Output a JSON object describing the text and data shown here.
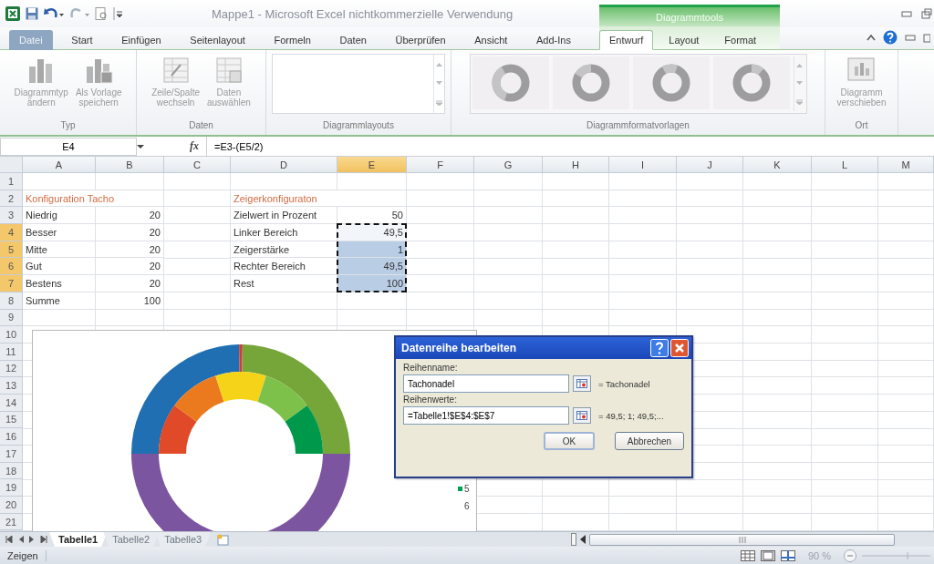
{
  "window": {
    "title": "Mappe1 - Microsoft Excel nichtkommerzielle Verwendung"
  },
  "context_tab_group": {
    "label": "Diagrammtools"
  },
  "ribbon_tabs": [
    {
      "label": "Datei",
      "kind": "file",
      "selected": false
    },
    {
      "label": "Start",
      "kind": "standard",
      "selected": false
    },
    {
      "label": "Einfügen",
      "kind": "standard",
      "selected": false
    },
    {
      "label": "Seitenlayout",
      "kind": "standard",
      "selected": false
    },
    {
      "label": "Formeln",
      "kind": "standard",
      "selected": false
    },
    {
      "label": "Daten",
      "kind": "standard",
      "selected": false
    },
    {
      "label": "Überprüfen",
      "kind": "standard",
      "selected": false
    },
    {
      "label": "Ansicht",
      "kind": "standard",
      "selected": false
    },
    {
      "label": "Add-Ins",
      "kind": "standard",
      "selected": false
    },
    {
      "label": "Entwurf",
      "kind": "context",
      "selected": true
    },
    {
      "label": "Layout",
      "kind": "context",
      "selected": false
    },
    {
      "label": "Format",
      "kind": "context",
      "selected": false
    }
  ],
  "ribbon_groups": [
    {
      "label": "Typ",
      "kind": "buttons",
      "buttons": [
        {
          "label": "Diagrammtyp\nändern",
          "disabled": true
        },
        {
          "label": "Als Vorlage\nspeichern",
          "disabled": true
        }
      ]
    },
    {
      "label": "Daten",
      "kind": "buttons",
      "buttons": [
        {
          "label": "Zeile/Spalte\nwechseln",
          "disabled": true
        },
        {
          "label": "Daten\nauswählen",
          "disabled": true
        }
      ]
    },
    {
      "label": "Diagrammlayouts",
      "kind": "gallery"
    },
    {
      "label": "Diagrammformatvorlagen",
      "kind": "styles"
    },
    {
      "label": "Ort",
      "kind": "buttons",
      "buttons": [
        {
          "label": "Diagramm\nverschieben",
          "disabled": true
        }
      ]
    }
  ],
  "formula_bar": {
    "name_box": "E4",
    "function_label": "fx",
    "formula": "=E3-(E5/2)"
  },
  "columns": [
    {
      "label": "A",
      "selected": false
    },
    {
      "label": "B",
      "selected": false
    },
    {
      "label": "C",
      "selected": false
    },
    {
      "label": "D",
      "selected": false
    },
    {
      "label": "E",
      "selected": true
    },
    {
      "label": "F",
      "selected": false
    },
    {
      "label": "G",
      "selected": false
    },
    {
      "label": "H",
      "selected": false
    },
    {
      "label": "I",
      "selected": false
    },
    {
      "label": "J",
      "selected": false
    },
    {
      "label": "K",
      "selected": false
    },
    {
      "label": "L",
      "selected": false
    },
    {
      "label": "M",
      "selected": false
    }
  ],
  "rows": [
    {
      "label": "1",
      "selected": false
    },
    {
      "label": "2",
      "selected": false,
      "cells": [
        {
          "text": "Konfiguration Tacho",
          "kind": "heading",
          "selected": false
        },
        null,
        null,
        {
          "text": "Zeigerkonfiguraton",
          "kind": "heading",
          "selected": false
        }
      ]
    },
    {
      "label": "3",
      "selected": false,
      "cells": [
        {
          "text": "Niedrig",
          "kind": "text",
          "selected": false
        },
        {
          "text": "20",
          "kind": "number",
          "selected": false
        },
        null,
        {
          "text": "Zielwert in Prozent",
          "kind": "text",
          "selected": false
        },
        {
          "text": "50",
          "kind": "number",
          "selected": false
        }
      ]
    },
    {
      "label": "4",
      "selected": true,
      "cells": [
        {
          "text": "Besser",
          "kind": "text",
          "selected": false
        },
        {
          "text": "20",
          "kind": "number",
          "selected": false
        },
        null,
        {
          "text": "Linker Bereich",
          "kind": "text",
          "selected": false
        },
        {
          "text": "49,5",
          "kind": "number",
          "selected": true
        }
      ]
    },
    {
      "label": "5",
      "selected": true,
      "cells": [
        {
          "text": "Mitte",
          "kind": "text",
          "selected": false
        },
        {
          "text": "20",
          "kind": "number",
          "selected": false
        },
        null,
        {
          "text": "Zeigerstärke",
          "kind": "text",
          "selected": false
        },
        {
          "text": "1",
          "kind": "number",
          "selected": true
        }
      ]
    },
    {
      "label": "6",
      "selected": true,
      "cells": [
        {
          "text": "Gut",
          "kind": "text",
          "selected": false
        },
        {
          "text": "20",
          "kind": "number",
          "selected": false
        },
        null,
        {
          "text": "Rechter Bereich",
          "kind": "text",
          "selected": false
        },
        {
          "text": "49,5",
          "kind": "number",
          "selected": true
        }
      ]
    },
    {
      "label": "7",
      "selected": true,
      "cells": [
        {
          "text": "Bestens",
          "kind": "text",
          "selected": false
        },
        {
          "text": "20",
          "kind": "number",
          "selected": false
        },
        null,
        {
          "text": "Rest",
          "kind": "text",
          "selected": false
        },
        {
          "text": "100",
          "kind": "number",
          "selected": true
        }
      ]
    },
    {
      "label": "8",
      "selected": false,
      "cells": [
        {
          "text": "Summe",
          "kind": "text",
          "selected": false
        },
        {
          "text": "100",
          "kind": "number",
          "selected": false
        }
      ]
    },
    {
      "label": "9",
      "selected": false
    },
    {
      "label": "10",
      "selected": false
    },
    {
      "label": "11",
      "selected": false
    },
    {
      "label": "12",
      "selected": false
    },
    {
      "label": "13",
      "selected": false
    },
    {
      "label": "14",
      "selected": false
    },
    {
      "label": "15",
      "selected": false
    },
    {
      "label": "16",
      "selected": false
    },
    {
      "label": "17",
      "selected": false
    },
    {
      "label": "18",
      "selected": false
    },
    {
      "label": "19",
      "selected": false
    },
    {
      "label": "20",
      "selected": false
    },
    {
      "label": "21",
      "selected": false
    }
  ],
  "chart": {
    "legend": [
      {
        "label": "5",
        "color": "#00a04f"
      },
      {
        "label": "6"
      }
    ]
  },
  "dialog": {
    "title": "Datenreihe bearbeiten",
    "fields": [
      {
        "label": "Reihenname:",
        "value": "Tachonadel",
        "preview": "= Tachonadel"
      },
      {
        "label": "Reihenwerte:",
        "value": "=Tabelle1!$E$4:$E$7",
        "preview": "= 49,5; 1; 49,5;..."
      }
    ],
    "buttons": [
      {
        "label": "OK",
        "kind": "default"
      },
      {
        "label": "Abbrechen",
        "kind": "cancel"
      }
    ]
  },
  "sheet_tabs": [
    {
      "label": "Tabelle1",
      "selected": true
    },
    {
      "label": "Tabelle2",
      "selected": false
    },
    {
      "label": "Tabelle3",
      "selected": false
    }
  ],
  "status_bar": {
    "mode": "Zeigen",
    "zoom": "90 %"
  }
}
